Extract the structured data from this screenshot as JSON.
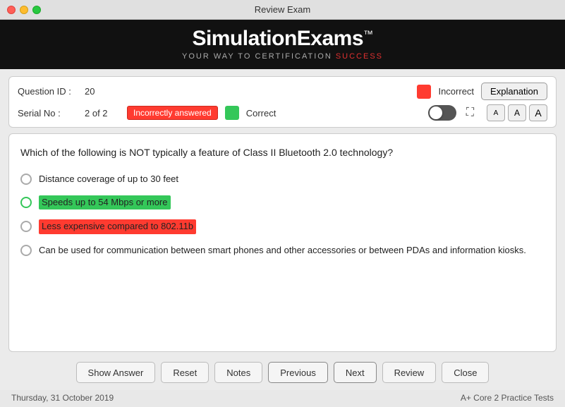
{
  "titleBar": {
    "title": "Review Exam"
  },
  "brand": {
    "title": "SimulationExams",
    "trademark": "™",
    "subtitle_1": "YOUR WAY TO CERTIFICATION",
    "subtitle_highlight": "SUCCESS"
  },
  "infoBar": {
    "questionIdLabel": "Question ID :",
    "questionIdValue": "20",
    "serialNoLabel": "Serial No :",
    "serialNoValue": "2 of 2",
    "incorrectLabel": "Incorrect",
    "correctLabel": "Correct",
    "incorrectlyAnsweredBadge": "Incorrectly answered",
    "explanationBtn": "Explanation",
    "fontBtns": [
      "A",
      "A",
      "A"
    ]
  },
  "question": {
    "text": "Which of the following is NOT typically a feature of Class II Bluetooth 2.0 technology?",
    "options": [
      {
        "id": "opt1",
        "text": "Distance coverage of up to 30 feet",
        "highlight": null,
        "selected": false
      },
      {
        "id": "opt2",
        "text": "Speeds up to 54 Mbps or more",
        "highlight": "green",
        "selected": true
      },
      {
        "id": "opt3",
        "text": "Less expensive compared to 802.11b",
        "highlight": "red",
        "selected": false
      },
      {
        "id": "opt4",
        "text": "Can be used for communication between smart phones and other accessories or between PDAs and information kiosks.",
        "highlight": null,
        "selected": false
      }
    ]
  },
  "buttons": {
    "showAnswer": "Show Answer",
    "reset": "Reset",
    "notes": "Notes",
    "previous": "Previous",
    "next": "Next",
    "review": "Review",
    "close": "Close"
  },
  "statusBar": {
    "date": "Thursday, 31 October 2019",
    "product": "A+ Core 2 Practice Tests"
  }
}
